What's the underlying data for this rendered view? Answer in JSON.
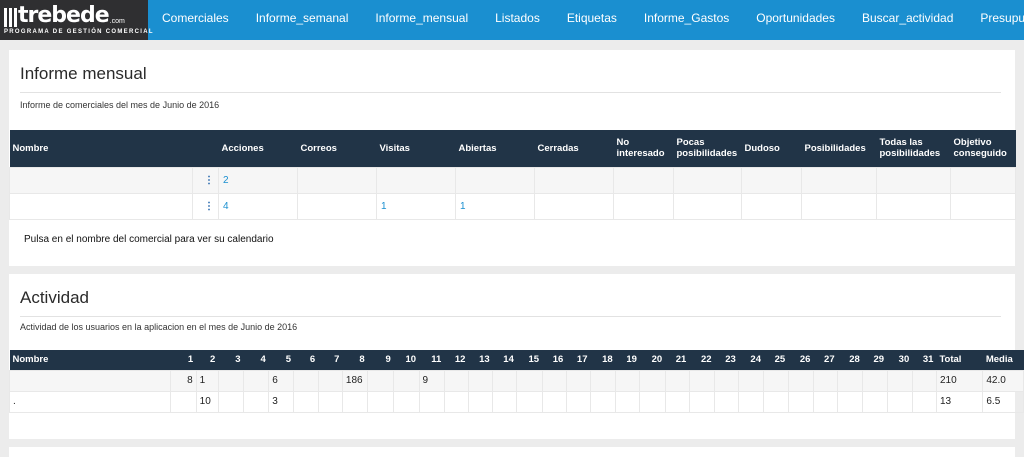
{
  "brand": {
    "name": "trebede",
    "suffix": ".com",
    "tagline": "PROGRAMA DE GESTIÓN COMERCIAL"
  },
  "nav": [
    "Comerciales",
    "Informe_semanal",
    "Informe_mensual",
    "Listados",
    "Etiquetas",
    "Informe_Gastos",
    "Oportunidades",
    "Buscar_actividad",
    "Presupuestos"
  ],
  "monthly": {
    "title": "Informe mensual",
    "subtitle": "Informe de comerciales del mes de Junio de 2016",
    "headers": [
      "Nombre",
      "",
      "Acciones",
      "Correos",
      "Visitas",
      "Abiertas",
      "Cerradas",
      "No interesado",
      "Pocas posibilidades",
      "Dudoso",
      "Posibilidades",
      "Todas las posibilidades",
      "Objetivo conseguido"
    ],
    "rows": [
      [
        "",
        "⋮",
        "2",
        "",
        "",
        "",
        "",
        "",
        "",
        "",
        "",
        "",
        ""
      ],
      [
        "",
        "⋮",
        "4",
        "",
        "1",
        "1",
        "",
        "",
        "",
        "",
        "",
        "",
        ""
      ]
    ],
    "note": "Pulsa en el nombre del comercial para ver su calendario"
  },
  "activity": {
    "title": "Actividad",
    "subtitle": "Actividad de los usuarios en la aplicacion en el mes de Junio de 2016",
    "headers": [
      "Nombre",
      "1",
      "2",
      "3",
      "4",
      "5",
      "6",
      "7",
      "8",
      "9",
      "10",
      "11",
      "12",
      "13",
      "14",
      "15",
      "16",
      "17",
      "18",
      "19",
      "20",
      "21",
      "22",
      "23",
      "24",
      "25",
      "26",
      "27",
      "28",
      "29",
      "30",
      "31",
      "Total",
      "Media"
    ],
    "rows": [
      [
        "",
        "8",
        "1",
        "",
        "",
        "6",
        "",
        "",
        "186",
        "",
        "",
        "9",
        "",
        "",
        "",
        "",
        "",
        "",
        "",
        "",
        "",
        "",
        "",
        "",
        "",
        "",
        "",
        "",
        "",
        "",
        "",
        "",
        "210",
        "42.0"
      ],
      [
        ".",
        "",
        "10",
        "",
        "",
        "3",
        "",
        "",
        "",
        "",
        "",
        "",
        "",
        "",
        "",
        "",
        "",
        "",
        "",
        "",
        "",
        "",
        "",
        "",
        "",
        "",
        "",
        "",
        "",
        "",
        "",
        "",
        "13",
        "6.5"
      ]
    ]
  }
}
